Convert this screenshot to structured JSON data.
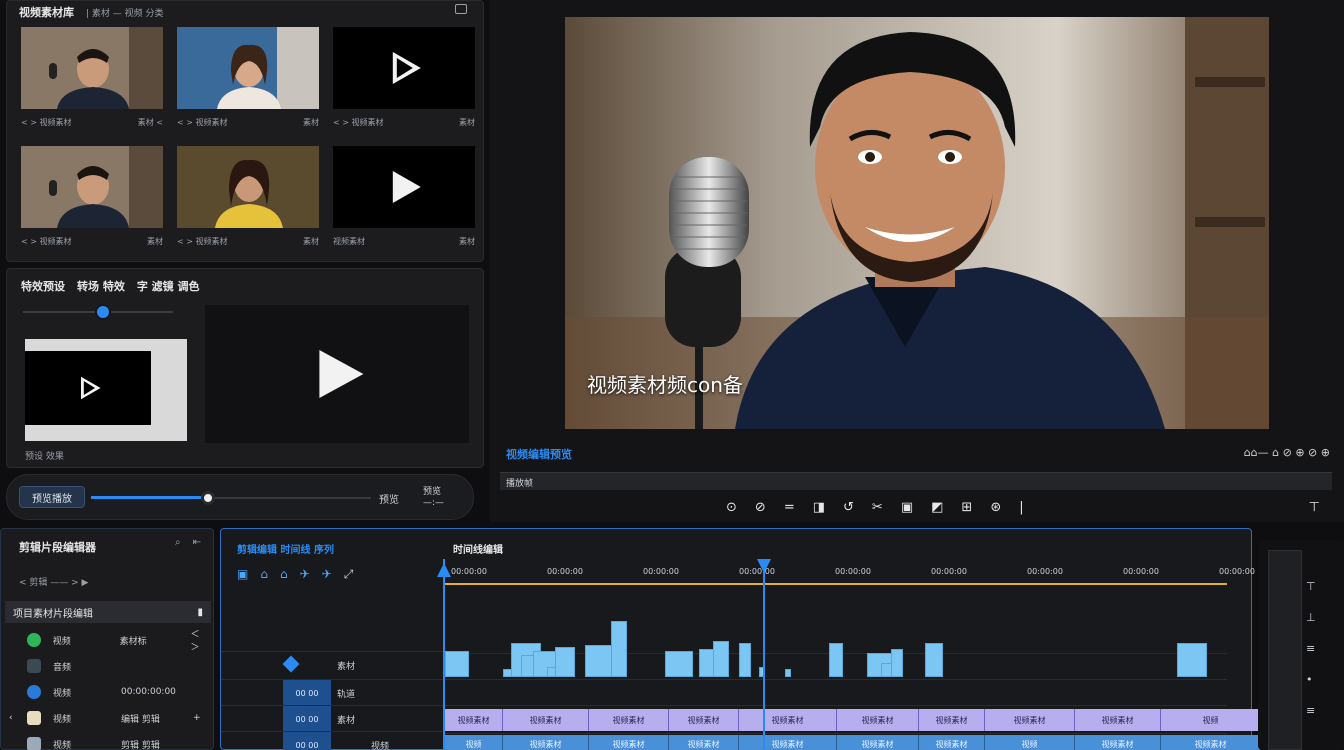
{
  "media_bin": {
    "title": "视频素材库",
    "subtitle": "| 素材 — 视频 分类",
    "thumbs": [
      {
        "caption_left": "< > 视频素材",
        "caption_right": "素材 <"
      },
      {
        "caption_left": "< > 视频素材",
        "caption_right": "素材"
      },
      {
        "caption_left": "< > 视频素材",
        "caption_right": "素材"
      },
      {
        "caption_left": "< > 视频素材",
        "caption_right": "素材"
      },
      {
        "caption_left": "< > 视频素材",
        "caption_right": "素材"
      },
      {
        "caption_left": "视频素材",
        "caption_right": "素材"
      }
    ]
  },
  "effects": {
    "tab1": "特效预设",
    "tab2": "转场 特效",
    "tab3": "字 滤镜 调色",
    "caption": "预设 效果"
  },
  "playbar": {
    "button": "预览播放",
    "time1": "预览",
    "time2": "预览\n—:—"
  },
  "viewer": {
    "caption": "视频素材频con备",
    "sequence_title": "视频编辑预览",
    "tools_right": "⌂⌂— ⌂ ⊘ ⊕ ⊘ ⊕",
    "mini_label": "播放帧",
    "toolbar": [
      "⊙",
      "⊘",
      "=",
      "◨",
      "↺",
      "✂",
      "▣",
      "◩",
      "⊞",
      "⊛",
      "|"
    ],
    "toolbar_end": "⊤"
  },
  "project": {
    "title": "剪辑片段编辑器",
    "info": "< 剪辑 —— > ▶",
    "header_label": "项目素材片段编辑",
    "header_badge": "▮",
    "rows": [
      {
        "name": "视频",
        "val": "素材标",
        "extra": "＜ ＞",
        "color": "#2fb45a"
      },
      {
        "name": "音频",
        "val": "",
        "extra": "",
        "color": "#3a4a52"
      },
      {
        "name": "视频",
        "val": "00:00:00:00",
        "extra": "",
        "color": "#2a7ad8"
      },
      {
        "name": "视频",
        "val": "编辑 剪辑",
        "extra": "+",
        "color": "#e8dcc0"
      },
      {
        "name": "视频",
        "val": "剪辑 剪辑",
        "extra": "",
        "color": "#9ab"
      }
    ]
  },
  "timeline": {
    "seq_label": "剪辑编辑 时间线 序列",
    "title": "时间线编辑",
    "tools": [
      "▣",
      "⌂",
      "⌂",
      "✈",
      "✈",
      "⤢"
    ],
    "ruler_ticks": [
      "00:00:00",
      "00:00:00",
      "00:00:00",
      "00:00:00",
      "00:00:00",
      "00:00:00",
      "00:00:00",
      "00:00:00",
      "00:00:00"
    ],
    "track_labels": [
      "",
      "素材",
      "轨道",
      "素材",
      "视频"
    ],
    "track_codes": [
      "00 00",
      "00 00",
      "00 00"
    ],
    "clips_a": [
      "视频素材",
      "视频素材",
      "视频素材",
      "视频素材",
      "视频素材",
      "视频素材",
      "视频素材",
      "视频素材",
      "视频素材",
      "视频"
    ],
    "clips_b": [
      "视频",
      "视频素材",
      "视频素材",
      "视频素材",
      "视频素材",
      "视频素材",
      "视频素材",
      "视频",
      "视频素材",
      "视频素材"
    ]
  },
  "rightstrip": {
    "icons": [
      "⊤",
      "⊥",
      "≡",
      "•",
      "≡"
    ]
  },
  "colors": {
    "accent": "#2a8bf2",
    "clip_purple": "#b7aef0",
    "clip_blue": "#4a90d9",
    "waveform": "#7cc6f4",
    "ruler_yellow": "#e2b22e"
  }
}
